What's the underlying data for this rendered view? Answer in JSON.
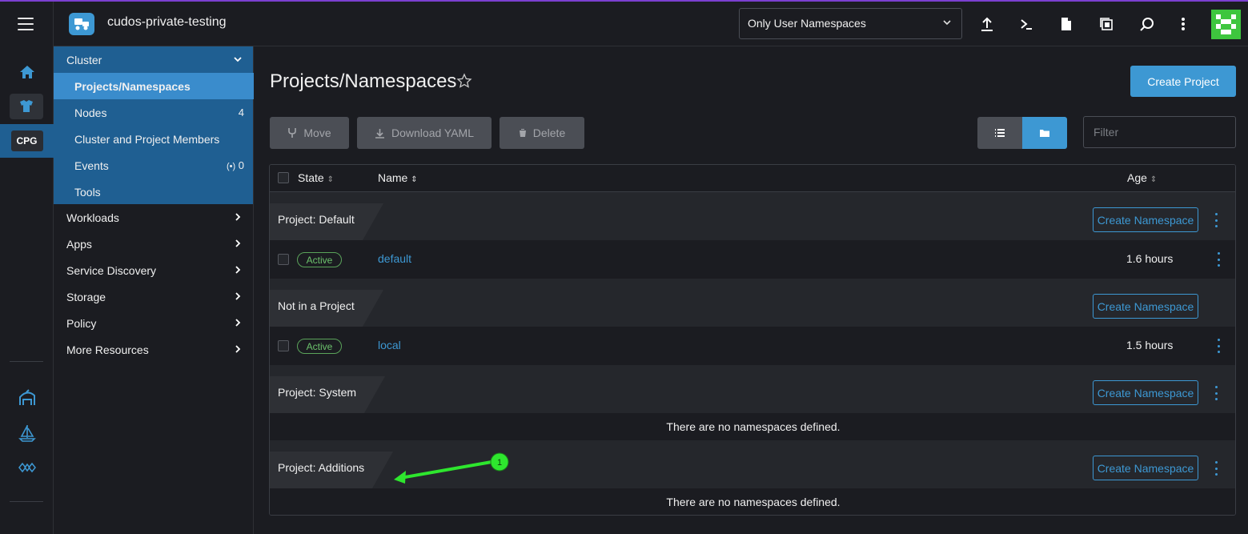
{
  "header": {
    "cluster_name": "cudos-private-testing",
    "namespace_filter": "Only User Namespaces",
    "avatar_color": "#3ec63e"
  },
  "rail": {
    "cluster_badge": "CPG"
  },
  "sidenav": {
    "cluster_label": "Cluster",
    "items": [
      {
        "label": "Projects/Namespaces",
        "count": ""
      },
      {
        "label": "Nodes",
        "count": "4"
      },
      {
        "label": "Cluster and Project Members",
        "count": ""
      },
      {
        "label": "Events",
        "count": "0"
      },
      {
        "label": "Tools",
        "count": ""
      }
    ],
    "groups": [
      "Workloads",
      "Apps",
      "Service Discovery",
      "Storage",
      "Policy",
      "More Resources"
    ]
  },
  "main": {
    "title": "Projects/Namespaces",
    "create_project": "Create Project",
    "toolbar": {
      "move": "Move",
      "download": "Download YAML",
      "delete": "Delete"
    },
    "filter_placeholder": "Filter",
    "columns": {
      "state": "State",
      "name": "Name",
      "age": "Age"
    },
    "create_namespace": "Create Namespace",
    "empty_text": "There are no namespaces defined.",
    "groups": [
      {
        "label": "Project:  Default",
        "rows": [
          {
            "state": "Active",
            "name": "default",
            "age": "1.6 hours"
          }
        ]
      },
      {
        "label": "Not in a Project",
        "rows": [
          {
            "state": "Active",
            "name": "local",
            "age": "1.5 hours"
          }
        ]
      },
      {
        "label": "Project:  System",
        "rows": []
      },
      {
        "label": "Project:  Additions",
        "rows": []
      }
    ]
  },
  "annotation": {
    "marker": "1",
    "color": "#2ee62e"
  }
}
